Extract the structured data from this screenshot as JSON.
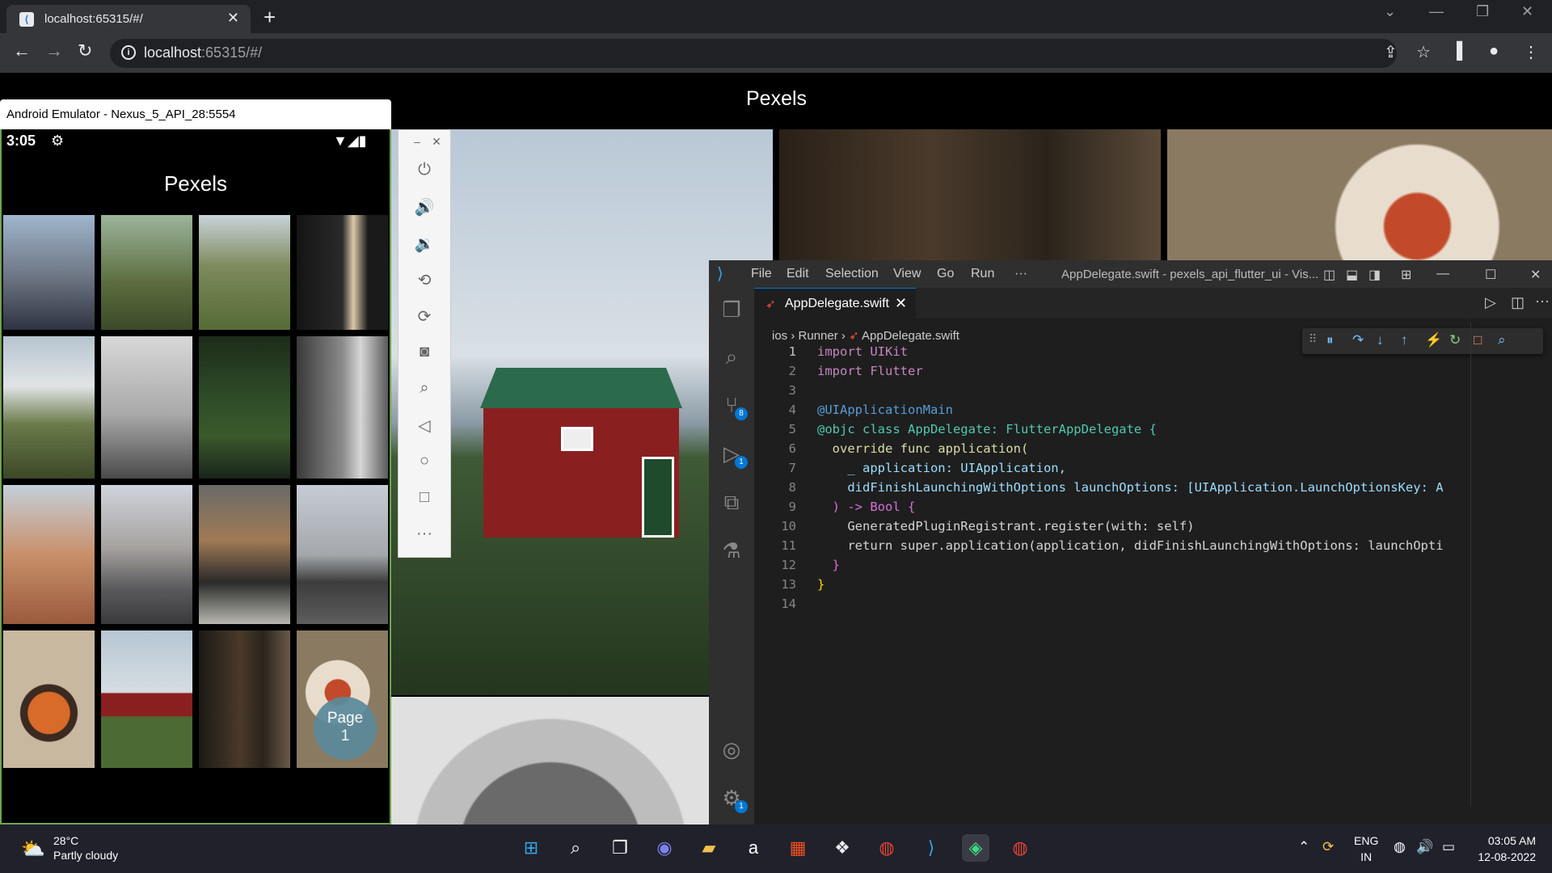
{
  "browser": {
    "tab_title": "localhost:65315/#/",
    "url_host": "localhost",
    "url_rest": ":65315/#/"
  },
  "web": {
    "title": "Pexels"
  },
  "emulator": {
    "window_title": "Android Emulator - Nexus_5_API_28:5554",
    "time": "3:05",
    "app_title": "Pexels",
    "page_badge_label": "Page",
    "page_badge_number": "1"
  },
  "vscode": {
    "menu": [
      "File",
      "Edit",
      "Selection",
      "View",
      "Go",
      "Run",
      "···"
    ],
    "window_title": "AppDelegate.swift - pexels_api_flutter_ui - Vis...",
    "tab_name": "AppDelegate.swift",
    "breadcrumb": [
      "ios",
      "Runner",
      "AppDelegate.swift"
    ],
    "badges": {
      "source_control": "8",
      "run_debug": "1",
      "settings": "1"
    },
    "line_numbers": [
      "1",
      "2",
      "3",
      "4",
      "5",
      "6",
      "7",
      "8",
      "9",
      "10",
      "11",
      "12",
      "13",
      "14"
    ],
    "code_lines": [
      "import UIKit",
      "import Flutter",
      "",
      "@UIApplicationMain",
      "@objc class AppDelegate: FlutterAppDelegate {",
      "  override func application(",
      "    _ application: UIApplication,",
      "    didFinishLaunchingWithOptions launchOptions: [UIApplication.LaunchOptionsKey: A",
      "  ) -> Bool {",
      "    GeneratedPluginRegistrant.register(with: self)",
      "    return super.application(application, didFinishLaunchingWithOptions: launchOpti",
      "  }",
      "}",
      ""
    ]
  },
  "taskbar": {
    "temperature": "28°C",
    "weather": "Partly cloudy",
    "lang_top": "ENG",
    "lang_bottom": "IN",
    "time": "03:05 AM",
    "date": "12-08-2022"
  }
}
